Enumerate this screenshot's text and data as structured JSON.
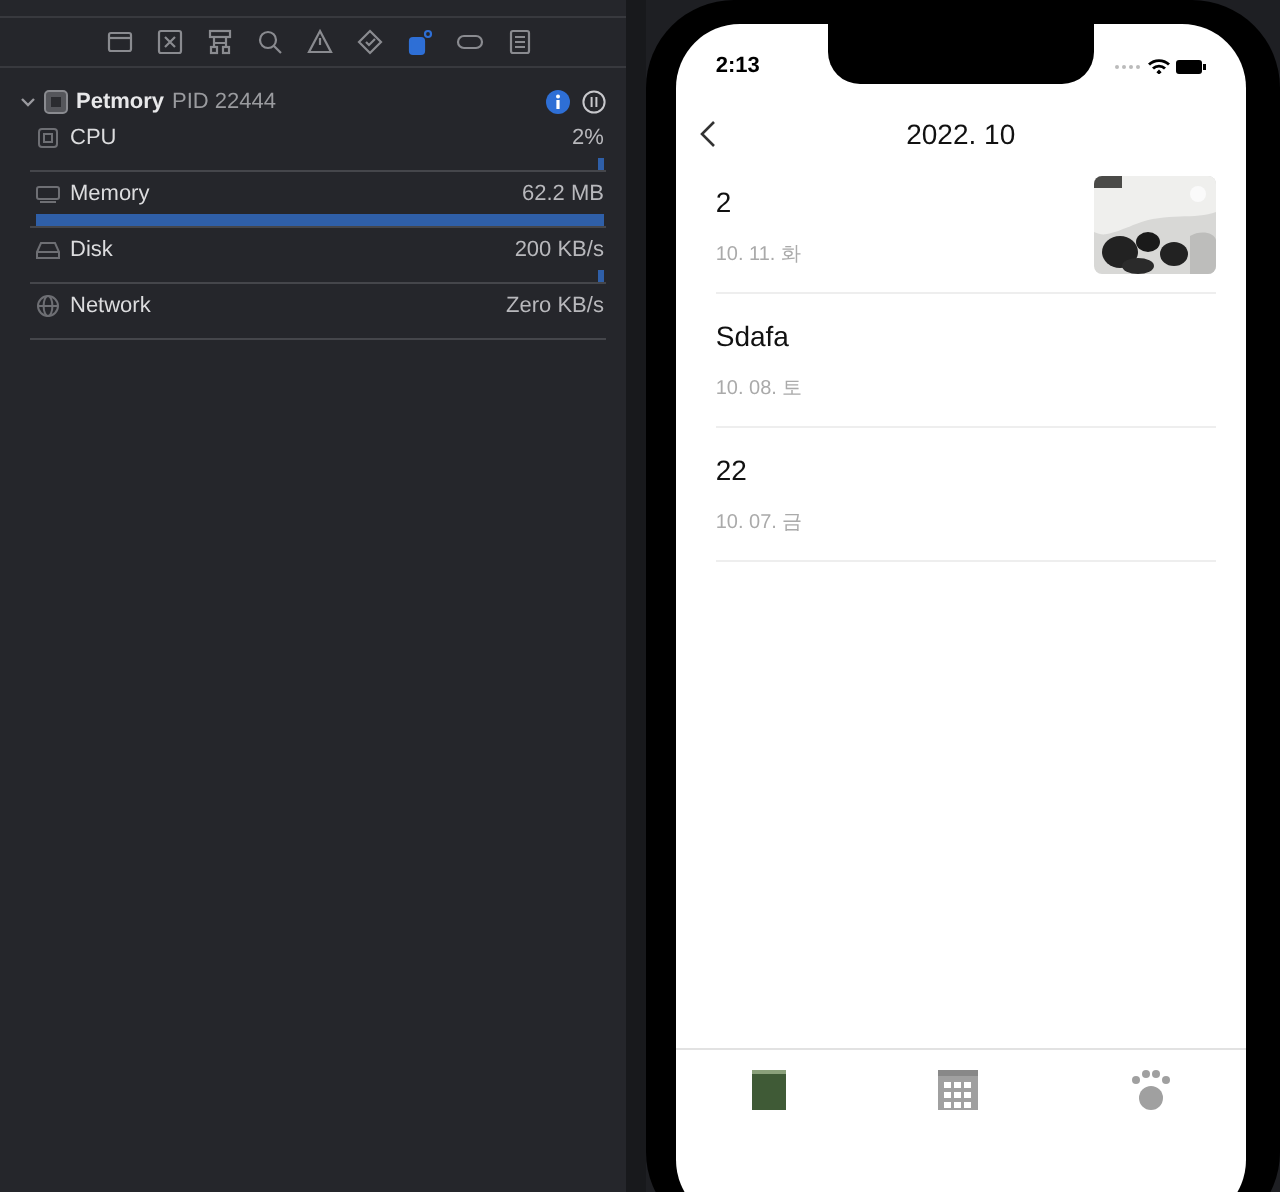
{
  "process": {
    "name": "Petmory",
    "pid": "PID 22444",
    "expanded": true
  },
  "gauges": [
    {
      "kind": "cpu",
      "label": "CPU",
      "reading": "2%",
      "level": 0.01
    },
    {
      "kind": "memory",
      "label": "Memory",
      "reading": "62.2 MB",
      "level": 1
    },
    {
      "kind": "disk",
      "label": "Disk",
      "reading": "200 KB/s",
      "level": 0.01
    },
    {
      "kind": "network",
      "label": "Network",
      "reading": "Zero KB/s"
    }
  ],
  "phone": {
    "time": "2:13",
    "title": "2022. 10",
    "entries": [
      {
        "title": "2",
        "date": "10. 11. 화",
        "has_photo": true
      },
      {
        "title": "Sdafa",
        "date": "10. 08. 토",
        "has_photo": false
      },
      {
        "title": "22",
        "date": "10. 07. 금",
        "has_photo": false
      }
    ],
    "tabs": [
      {
        "kind": "book",
        "selected": true
      },
      {
        "kind": "calendar",
        "selected": false
      },
      {
        "kind": "paw",
        "selected": false
      }
    ]
  }
}
